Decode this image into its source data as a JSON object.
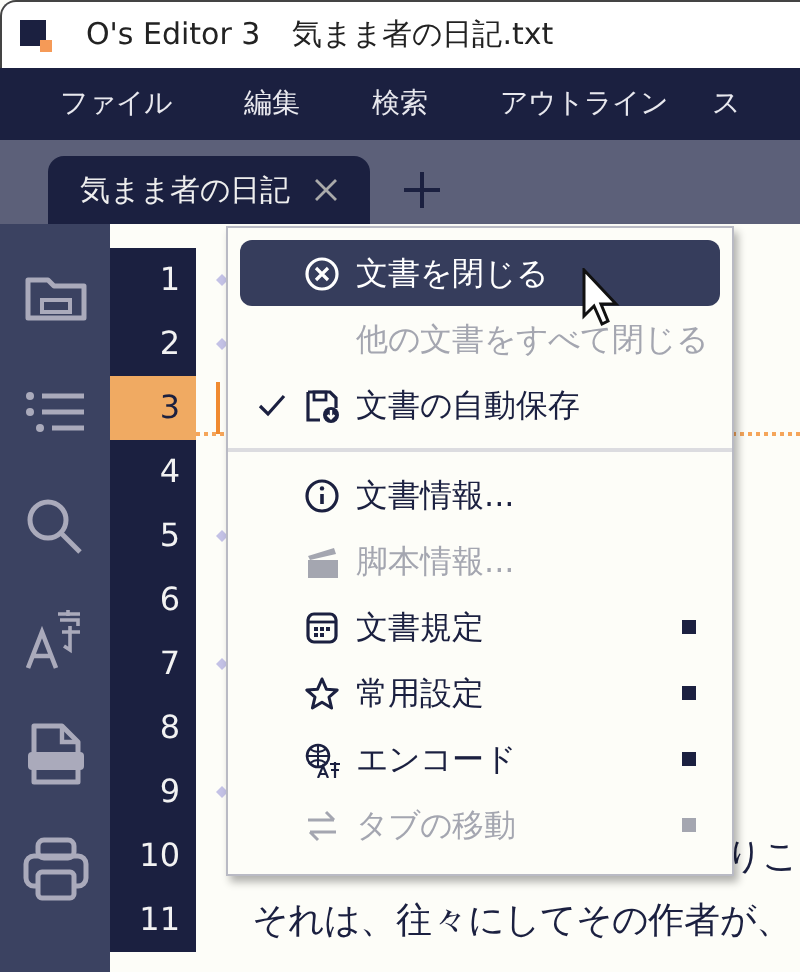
{
  "window": {
    "app_title": "O's Editor 3",
    "file_title": "気まま者の日記.txt"
  },
  "menu_bar": [
    "ファイル",
    "編集",
    "検索",
    "アウトライン",
    "ス"
  ],
  "tabs": [
    {
      "label": "気まま者の日記",
      "selected": true
    }
  ],
  "sidebar": {
    "items": [
      {
        "kind": "folder"
      },
      {
        "kind": "outline"
      },
      {
        "kind": "search"
      },
      {
        "kind": "font"
      },
      {
        "kind": "pdf"
      },
      {
        "kind": "print"
      }
    ]
  },
  "editor": {
    "lines": [
      {
        "number": "1",
        "current": false,
        "marker": true
      },
      {
        "number": "2",
        "current": false,
        "marker": true
      },
      {
        "number": "3",
        "current": true,
        "marker": false
      },
      {
        "number": "4",
        "current": false,
        "marker": false
      },
      {
        "number": "5",
        "current": false,
        "marker": true
      },
      {
        "number": "6",
        "current": false,
        "marker": false
      },
      {
        "number": "7",
        "current": false,
        "marker": true
      },
      {
        "number": "8",
        "current": false,
        "marker": false
      },
      {
        "number": "9",
        "current": false,
        "marker": true
      },
      {
        "number": "10",
        "current": false,
        "marker": false,
        "text": "りこ"
      },
      {
        "number": "11",
        "current": false,
        "marker": false,
        "text": "　それは、往々にしてその作者が、"
      }
    ]
  },
  "context_menu": {
    "items": [
      {
        "kind": "item",
        "label": "文書を閉じる",
        "selected": true,
        "disabled": false,
        "checked": false,
        "submenu": false
      },
      {
        "kind": "item",
        "label": "他の文書をすべて閉じる",
        "selected": false,
        "disabled": true,
        "checked": false,
        "submenu": false
      },
      {
        "kind": "item",
        "label": "文書の自動保存",
        "selected": false,
        "disabled": false,
        "checked": true,
        "submenu": false
      },
      {
        "kind": "separator"
      },
      {
        "kind": "item",
        "label": "文書情報...",
        "selected": false,
        "disabled": false,
        "checked": false,
        "submenu": false
      },
      {
        "kind": "item",
        "label": "脚本情報...",
        "selected": false,
        "disabled": true,
        "checked": false,
        "submenu": false
      },
      {
        "kind": "item",
        "label": "文書規定",
        "selected": false,
        "disabled": false,
        "checked": false,
        "submenu": true
      },
      {
        "kind": "item",
        "label": "常用設定",
        "selected": false,
        "disabled": false,
        "checked": false,
        "submenu": true
      },
      {
        "kind": "item",
        "label": "エンコード",
        "selected": false,
        "disabled": false,
        "checked": false,
        "submenu": true
      },
      {
        "kind": "item",
        "label": "タブの移動",
        "selected": false,
        "disabled": true,
        "checked": false,
        "submenu": true
      }
    ]
  }
}
